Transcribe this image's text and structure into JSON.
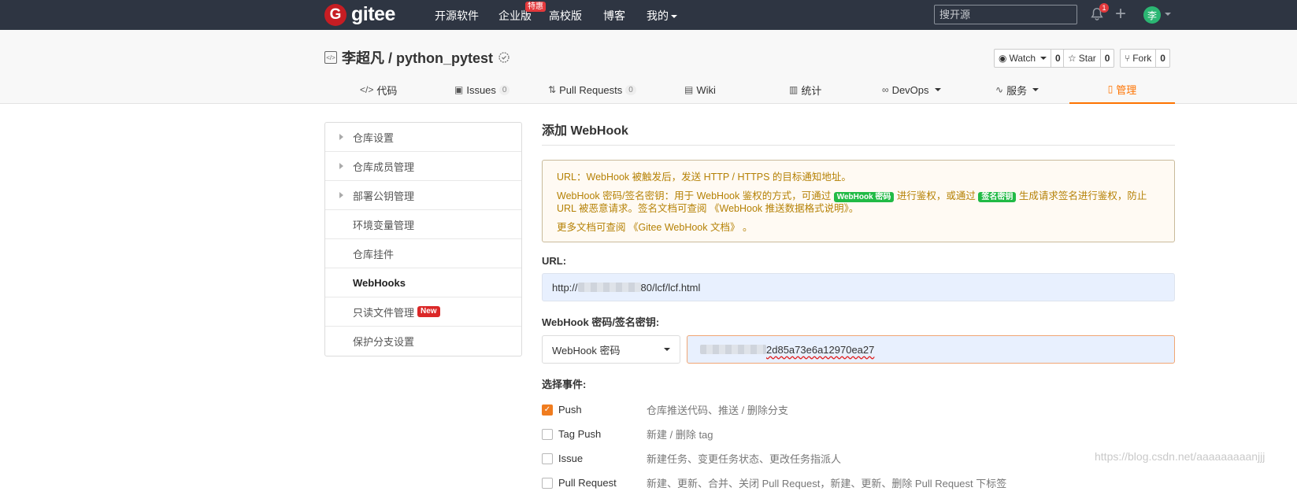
{
  "topbar": {
    "logo_glyph": "G",
    "logo_text": "gitee",
    "nav": [
      "开源软件",
      "企业版",
      "高校版",
      "博客",
      "我的"
    ],
    "hot_badge": "特惠",
    "search_placeholder": "搜开源",
    "notification_count": "1",
    "avatar_text": "李"
  },
  "repo": {
    "title": "李超凡 / python_pytest",
    "watch_label": "Watch",
    "watch_count": "0",
    "star_label": "Star",
    "star_count": "0",
    "fork_label": "Fork",
    "fork_count": "0"
  },
  "tabs": [
    {
      "label": "代码",
      "icon": "code-icon"
    },
    {
      "label": "Issues",
      "count": "0",
      "icon": "issues-icon"
    },
    {
      "label": "Pull Requests",
      "count": "0",
      "icon": "pull-request-icon"
    },
    {
      "label": "Wiki",
      "icon": "wiki-icon"
    },
    {
      "label": "统计",
      "icon": "chart-icon"
    },
    {
      "label": "DevOps",
      "icon": "infinity-icon"
    },
    {
      "label": "服务",
      "icon": "pulse-icon"
    },
    {
      "label": "管理",
      "icon": "manage-icon"
    }
  ],
  "sidebar": [
    {
      "label": "仓库设置"
    },
    {
      "label": "仓库成员管理"
    },
    {
      "label": "部署公钥管理"
    },
    {
      "label": "环境变量管理"
    },
    {
      "label": "仓库挂件"
    },
    {
      "label": "WebHooks"
    },
    {
      "label": "只读文件管理",
      "badge": "New"
    },
    {
      "label": "保护分支设置"
    }
  ],
  "main": {
    "title": "添加 WebHook",
    "notice": {
      "line1": "URL：WebHook 被触发后，发送 HTTP / HTTPS 的目标通知地址。",
      "line2a": "WebHook 密码/签名密钥：用于 WebHook 鉴权的方式，可通过",
      "tag1": "WebHook 密码",
      "line2b": "进行鉴权，或通过",
      "tag2": "签名密钥",
      "line2c": "生成请求签名进行鉴权，防止 URL 被恶意请求。签名文档可查阅",
      "line2link": "《WebHook 推送数据格式说明》",
      "line2end": "。",
      "line3a": "更多文档可查阅",
      "line3link": "《Gitee WebHook 文档》",
      "line3end": "。"
    },
    "url_label": "URL:",
    "url_prefix": "http://",
    "url_suffix": "80/lcf/lcf.html",
    "secret_label": "WebHook 密码/签名密钥:",
    "secret_type": "WebHook 密码",
    "secret_value": "2d85a73e6a12970ea27",
    "events_label": "选择事件:",
    "events": [
      {
        "name": "Push",
        "desc": "仓库推送代码、推送 / 删除分支",
        "checked": true
      },
      {
        "name": "Tag Push",
        "desc": "新建 / 删除 tag",
        "checked": false
      },
      {
        "name": "Issue",
        "desc": "新建任务、变更任务状态、更改任务指派人",
        "checked": false
      },
      {
        "name": "Pull Request",
        "desc": "新建、更新、合并、关闭 Pull Request，新建、更新、删除 Pull Request 下标签",
        "checked": false
      }
    ]
  },
  "watermark": "https://blog.csdn.net/aaaaaaaaanjjj",
  "colors": {
    "accent": "#fe7300",
    "topbar": "#2e3542",
    "brand": "#c71d23"
  }
}
